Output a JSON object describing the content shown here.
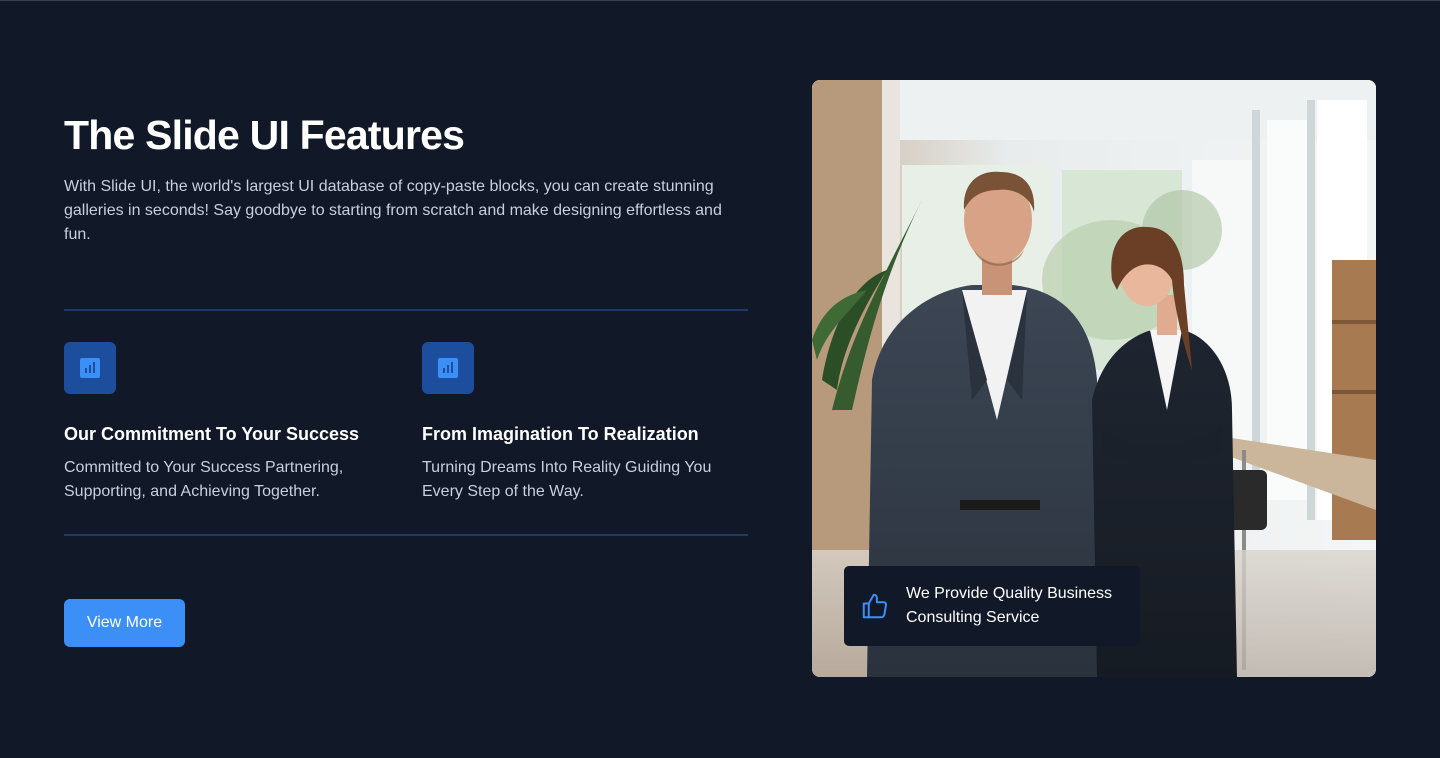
{
  "hero": {
    "title": "The Slide UI Features",
    "description": "With Slide UI, the world's largest UI database of copy-paste blocks, you can create stunning galleries in seconds! Say goodbye to starting from scratch and make designing effortless and fun."
  },
  "features": [
    {
      "icon": "chart-icon",
      "title": "Our Commitment To Your Success",
      "description": "Committed to Your Success Partnering, Supporting, and Achieving Together."
    },
    {
      "icon": "chart-icon",
      "title": "From Imagination To Realization",
      "description": "Turning Dreams Into Reality Guiding You Every Step of the Way."
    }
  ],
  "cta": {
    "label": "View More"
  },
  "badge": {
    "icon": "thumbs-up-icon",
    "text": "We Provide Quality Business Consulting Service"
  },
  "colors": {
    "background": "#111827",
    "accent": "#3b8ff6",
    "icon_tile": "#1d4e9e",
    "divider": "#1e3a67",
    "muted_text": "#c7d0dd"
  }
}
